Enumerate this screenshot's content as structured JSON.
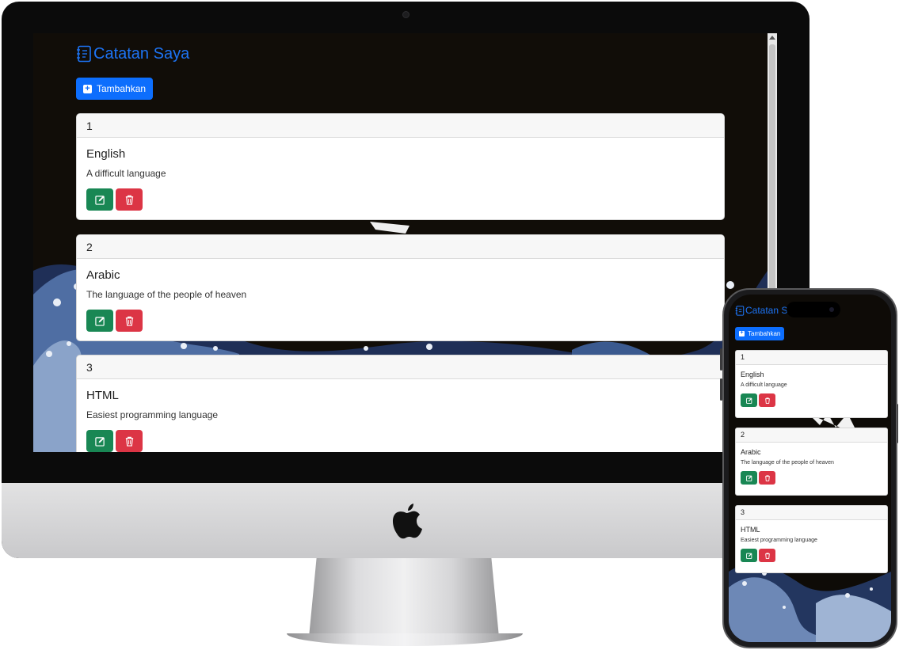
{
  "app": {
    "title": "Catatan Saya",
    "add_label": "Tambahkan"
  },
  "notes": [
    {
      "number": "1",
      "title": "English",
      "description": "A difficult language"
    },
    {
      "number": "2",
      "title": "Arabic",
      "description": "The language of the people of heaven"
    },
    {
      "number": "3",
      "title": "HTML",
      "description": "Easiest programming language"
    }
  ],
  "mobile": {
    "title": "Catatan Sa"
  },
  "icons": {
    "brand": "notebook-icon",
    "add": "plus-square-icon",
    "edit": "pencil-square-icon",
    "delete": "trash-icon"
  },
  "colors": {
    "primary": "#0d6efd",
    "edit": "#198754",
    "delete": "#dc3545",
    "brand_text": "#1d74f5"
  }
}
